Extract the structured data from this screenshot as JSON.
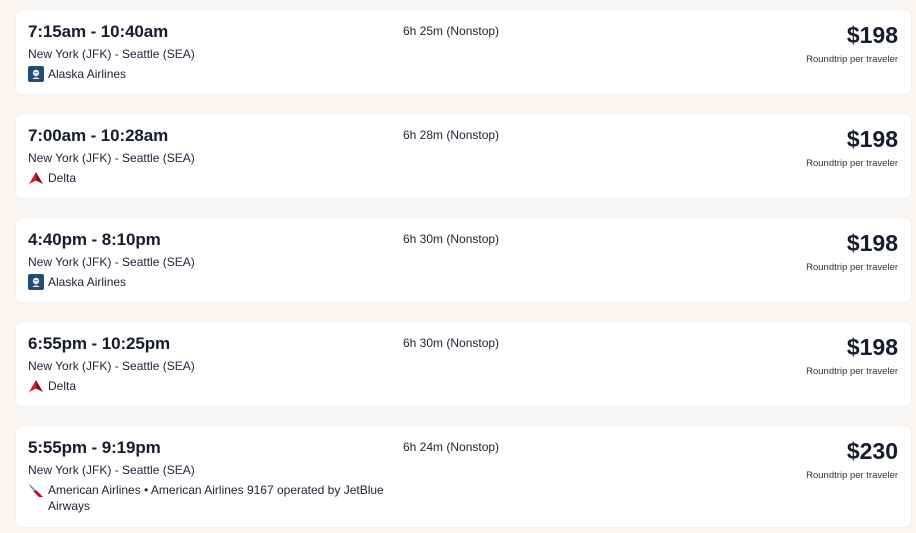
{
  "flights": [
    {
      "times": "7:15am - 10:40am",
      "route": "New York (JFK) - Seattle (SEA)",
      "airline": "Alaska Airlines",
      "airline_icon": "alaska-airlines-logo-icon",
      "duration": "6h 25m (Nonstop)",
      "price": "$198",
      "price_note": "Roundtrip per traveler"
    },
    {
      "times": "7:00am - 10:28am",
      "route": "New York (JFK) - Seattle (SEA)",
      "airline": "Delta",
      "airline_icon": "delta-logo-icon",
      "duration": "6h 28m (Nonstop)",
      "price": "$198",
      "price_note": "Roundtrip per traveler"
    },
    {
      "times": "4:40pm - 8:10pm",
      "route": "New York (JFK) - Seattle (SEA)",
      "airline": "Alaska Airlines",
      "airline_icon": "alaska-airlines-logo-icon",
      "duration": "6h 30m (Nonstop)",
      "price": "$198",
      "price_note": "Roundtrip per traveler"
    },
    {
      "times": "6:55pm - 10:25pm",
      "route": "New York (JFK) - Seattle (SEA)",
      "airline": "Delta",
      "airline_icon": "delta-logo-icon",
      "duration": "6h 30m (Nonstop)",
      "price": "$198",
      "price_note": "Roundtrip per traveler"
    },
    {
      "times": "5:55pm - 9:19pm",
      "route": "New York (JFK) - Seattle (SEA)",
      "airline": "American Airlines • American Airlines 9167 operated by JetBlue Airways",
      "airline_icon": "american-airlines-logo-icon",
      "duration": "6h 24m (Nonstop)",
      "price": "$230",
      "price_note": "Roundtrip per traveler"
    }
  ],
  "colors": {
    "page_background": "#f7f4f2",
    "card_background": "#ffffff",
    "text_primary": "#161b2e",
    "alaska_blue": "#1f4e79",
    "delta_red": "#c8102e",
    "american_blue": "#0f3a6e",
    "american_red": "#c30019"
  }
}
